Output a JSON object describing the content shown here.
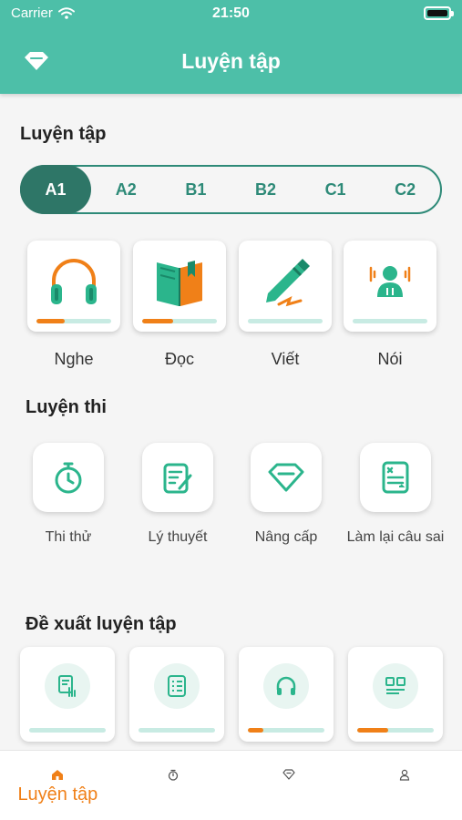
{
  "status_bar": {
    "carrier": "Carrier",
    "time": "21:50"
  },
  "header": {
    "title": "Luyện tập",
    "left_icon": "diamond-icon"
  },
  "practice": {
    "title": "Luyện tập",
    "levels": [
      "A1",
      "A2",
      "B1",
      "B2",
      "C1",
      "C2"
    ],
    "selected_level": "A1",
    "skills": [
      {
        "label": "Nghe",
        "icon": "headphones-icon",
        "progress": 0.38
      },
      {
        "label": "Đọc",
        "icon": "book-icon",
        "progress": 0.42
      },
      {
        "label": "Viết",
        "icon": "pen-icon",
        "progress": 0
      },
      {
        "label": "Nói",
        "icon": "speaker-person-icon",
        "progress": 0
      }
    ]
  },
  "exam": {
    "title": "Luyện thi",
    "items": [
      {
        "label": "Thi thử",
        "icon": "stopwatch-icon"
      },
      {
        "label": "Lý thuyết",
        "icon": "notebook-pen-icon"
      },
      {
        "label": "Nâng cấp",
        "icon": "diamond-icon"
      },
      {
        "label": "Làm lại câu sai",
        "icon": "retry-list-icon"
      }
    ]
  },
  "suggestions": {
    "title": "Đề xuất luyện tập",
    "items": [
      {
        "icon": "tap-document-icon",
        "progress": 0
      },
      {
        "icon": "checklist-icon",
        "progress": 0
      },
      {
        "icon": "headphones-icon",
        "progress": 0.2
      },
      {
        "icon": "quiz-grid-icon",
        "progress": 0.4
      }
    ]
  },
  "bottom_nav": {
    "items": [
      {
        "label": "Luyện tập",
        "icon": "home-icon",
        "active": true
      },
      {
        "label": "",
        "icon": "stopwatch-icon",
        "active": false
      },
      {
        "label": "",
        "icon": "diamond-icon",
        "active": false
      },
      {
        "label": "",
        "icon": "user-icon",
        "active": false
      }
    ]
  },
  "colors": {
    "primary": "#4dbfa8",
    "primary_dark": "#2e7667",
    "accent": "#f08018",
    "track": "#c8ebe3"
  }
}
